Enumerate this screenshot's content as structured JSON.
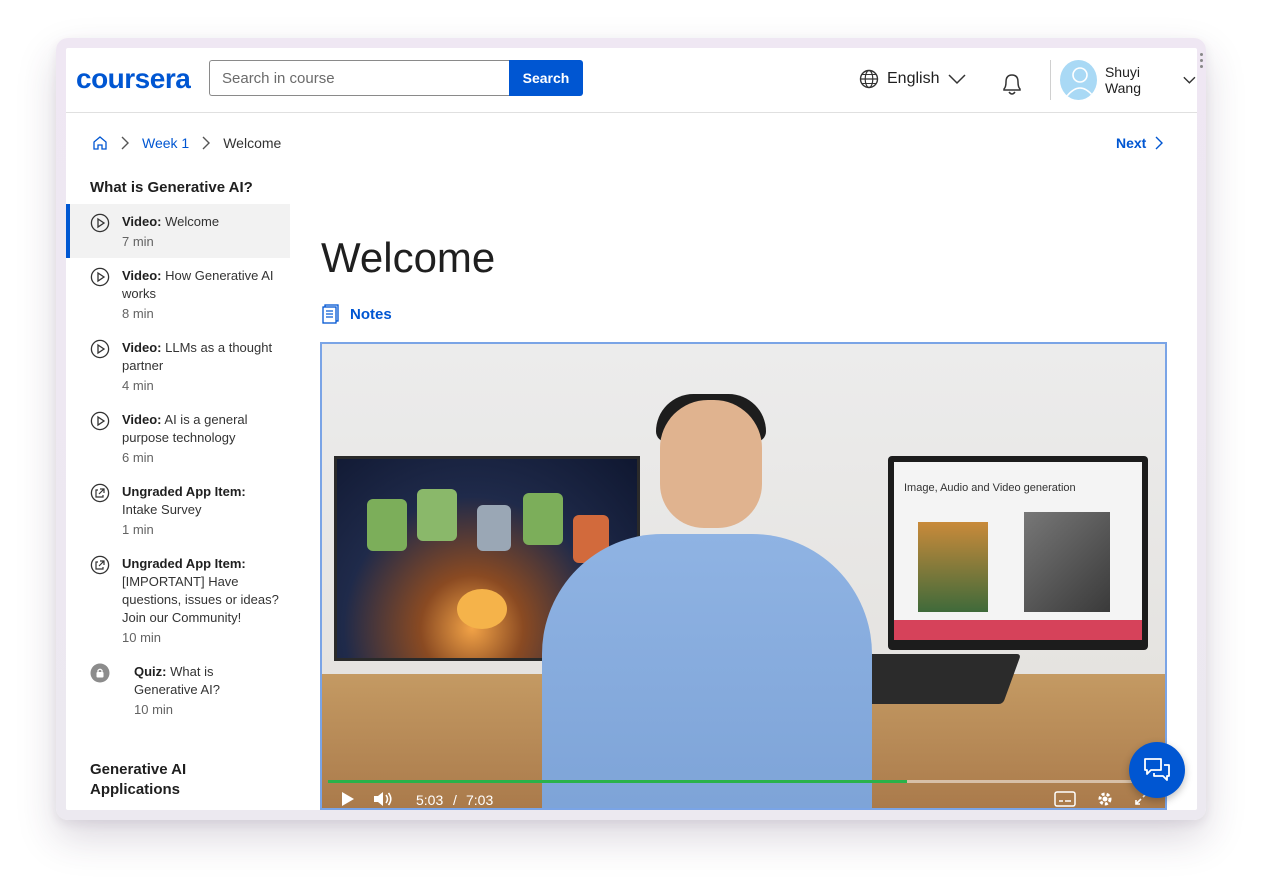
{
  "header": {
    "logo": "coursera",
    "search_placeholder": "Search in course",
    "search_button": "Search",
    "language": "English",
    "user_name": "Shuyi Wang"
  },
  "breadcrumb": {
    "week": "Week 1",
    "current": "Welcome",
    "next": "Next"
  },
  "sidebar": {
    "section1_title": "What is Generative AI?",
    "items": [
      {
        "type": "Video:",
        "title": "Welcome",
        "duration": "7 min",
        "icon": "play-icon",
        "active": true
      },
      {
        "type": "Video:",
        "title": "How Generative AI works",
        "duration": "8 min",
        "icon": "play-icon"
      },
      {
        "type": "Video:",
        "title": "LLMs as a thought partner",
        "duration": "4 min",
        "icon": "play-icon"
      },
      {
        "type": "Video:",
        "title": "AI is a general purpose technology",
        "duration": "6 min",
        "icon": "play-icon"
      },
      {
        "type": "Ungraded App Item:",
        "title": "Intake Survey",
        "duration": "1 min",
        "icon": "external-link-icon"
      },
      {
        "type": "Ungraded App Item:",
        "title": "[IMPORTANT] Have questions, issues or ideas? Join our Community!",
        "duration": "10 min",
        "icon": "external-link-icon"
      },
      {
        "type": "Quiz:",
        "title": "What is Generative AI?",
        "duration": "10 min",
        "icon": "lock-icon"
      }
    ],
    "section2_title": "Generative AI Applications"
  },
  "main": {
    "title": "Welcome",
    "notes": "Notes"
  },
  "video": {
    "slide_title": "Image, Audio and Video generation",
    "current_time": "5:03",
    "separator": "/",
    "total_time": "7:03",
    "progress": 0.72
  },
  "colors": {
    "accent": "#0056d2",
    "progress": "#2ab24a",
    "active_bg": "#f2f2f2"
  }
}
